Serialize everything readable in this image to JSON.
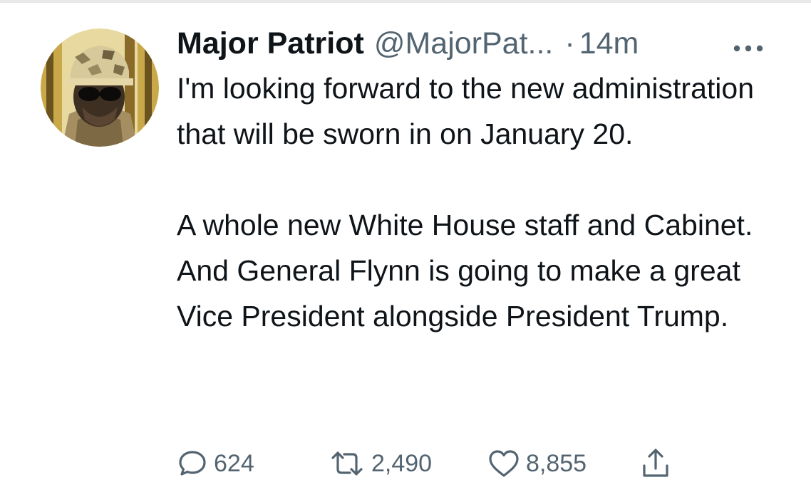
{
  "tweet": {
    "display_name": "Major Patriot",
    "handle": "@MajorPat...",
    "separator": "·",
    "timestamp": "14m",
    "more_icon": "more-horizontal-icon",
    "avatar_icon": "avatar-image",
    "paragraphs": [
      "I'm looking forward to the new administration that will be sworn in on January 20.",
      "A whole new White House staff and Cabinet.  And General Flynn is going to make a great Vice President alongside President Trump."
    ]
  },
  "actions": {
    "reply": {
      "icon": "reply-icon",
      "count": "624"
    },
    "retweet": {
      "icon": "retweet-icon",
      "count": "2,490"
    },
    "like": {
      "icon": "heart-icon",
      "count": "8,855"
    },
    "share": {
      "icon": "share-icon"
    }
  },
  "colors": {
    "primary_text": "#0f1419",
    "secondary_text": "#536471",
    "divider": "#e7e9ea"
  }
}
